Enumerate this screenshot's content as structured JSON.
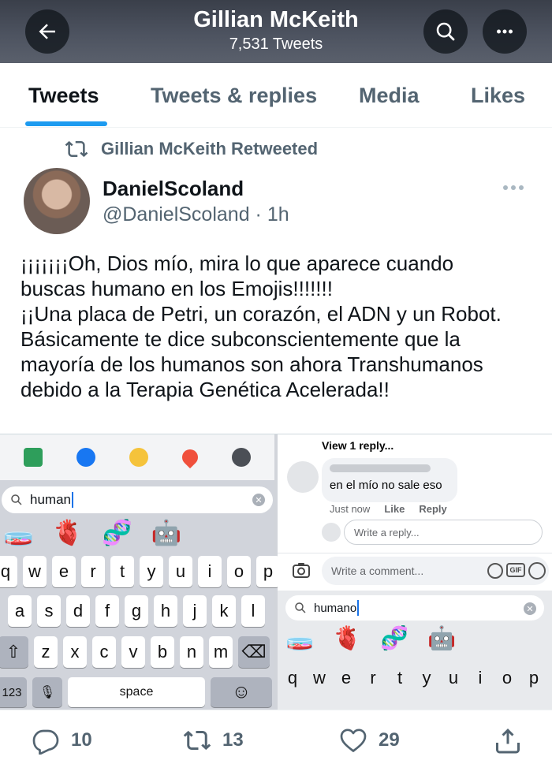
{
  "header": {
    "title": "Gillian McKeith",
    "subtitle": "7,531 Tweets"
  },
  "tabs": [
    {
      "label": "Tweets",
      "active": true
    },
    {
      "label": "Tweets & replies",
      "active": false
    },
    {
      "label": "Media",
      "active": false
    },
    {
      "label": "Likes",
      "active": false
    }
  ],
  "tweet": {
    "retweet_context": "Gillian McKeith Retweeted",
    "author_name": "DanielScoland",
    "author_handle": "@DanielScoland · 1h",
    "text": "¡¡¡¡¡¡¡Oh, Dios mío, mira lo que aparece cuando\nbuscas humano en los Emojis!!!!!!!\n¡¡Una placa de Petri, un corazón, el ADN y un Robot.\nBásicamente te dice subconscientemente que la\nmayoría de los humanos son ahora Transhumanos\ndebido a la Terapia Genética Acelerada!!",
    "reply_count": "10",
    "retweet_count": "13",
    "like_count": "29"
  },
  "media": {
    "left": {
      "search_value": "human",
      "emojis": [
        "🧫",
        "🫀",
        "🧬",
        "🤖"
      ],
      "keys_row1": [
        "q",
        "w",
        "e",
        "r",
        "t",
        "y",
        "u",
        "i",
        "o",
        "p"
      ],
      "keys_row2": [
        "a",
        "s",
        "d",
        "f",
        "g",
        "h",
        "j",
        "k",
        "l"
      ],
      "keys_row3": [
        "z",
        "x",
        "c",
        "v",
        "b",
        "n",
        "m"
      ],
      "shift_key": "⇧",
      "delete_key": "⌫",
      "num_key": "123",
      "mic_key": "🎙",
      "space_key": "space",
      "emoji_key": "☺"
    },
    "right": {
      "view_replies": "View 1 reply...",
      "comment_text": "en el mío no sale eso",
      "comment_time": "Just now",
      "like_label": "Like",
      "reply_label": "Reply",
      "reply_placeholder": "Write a reply...",
      "comment_placeholder": "Write a comment...",
      "gif_label": "GIF",
      "search_value": "humano",
      "emojis": [
        "🧫",
        "🫀",
        "🧬",
        "🤖"
      ],
      "keys_row1": [
        "q",
        "w",
        "e",
        "r",
        "t",
        "y",
        "u",
        "i",
        "o",
        "p"
      ]
    }
  },
  "colors": {
    "accent": "#1d9bf0",
    "text": "#0f1419",
    "muted": "#536471"
  }
}
